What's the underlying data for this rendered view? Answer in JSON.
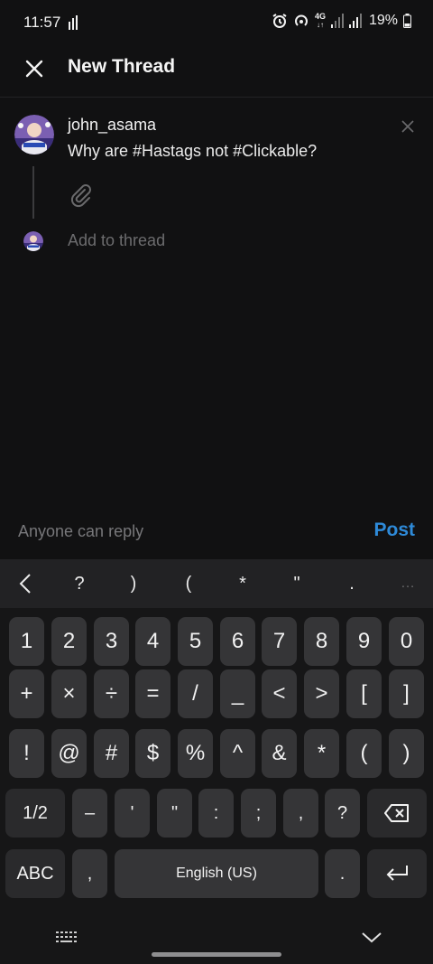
{
  "status_bar": {
    "time": "11:57",
    "battery": "19%",
    "network": "4G",
    "icons": [
      "signal-bars-icon",
      "alarm-icon",
      "hotspot-icon",
      "4g-icon",
      "signal-icon",
      "signal-icon",
      "battery-icon"
    ]
  },
  "app_bar": {
    "title": "New Thread",
    "close_icon": "close-icon"
  },
  "post": {
    "username": "john_asama",
    "text": "Why are #Hastags not #Clickable?",
    "remove_icon": "close-icon",
    "attach_icon": "paperclip-icon"
  },
  "add_thread": {
    "placeholder": "Add to thread"
  },
  "composer_footer": {
    "reply_setting": "Anyone can reply",
    "post_label": "Post",
    "post_color": "#2e8ad8"
  },
  "keyboard": {
    "toolbar": [
      "<",
      "?",
      ")",
      "(",
      "*",
      "\"",
      ".",
      "…"
    ],
    "rows": [
      [
        "1",
        "2",
        "3",
        "4",
        "5",
        "6",
        "7",
        "8",
        "9",
        "0"
      ],
      [
        "+",
        "×",
        "÷",
        "=",
        "/",
        "_",
        "<",
        ">",
        "[",
        "]"
      ],
      [
        "!",
        "@",
        "#",
        "$",
        "%",
        "^",
        "&",
        "*",
        "(",
        ")"
      ],
      [
        "1/2",
        "–",
        "'",
        "\"",
        ":",
        ";",
        ",",
        "?",
        "⌫"
      ],
      [
        "ABC",
        ",",
        "English (US)",
        ".",
        "↵"
      ]
    ],
    "bottom_icons": [
      "keyboard-switch-icon",
      "hide-keyboard-icon"
    ]
  }
}
